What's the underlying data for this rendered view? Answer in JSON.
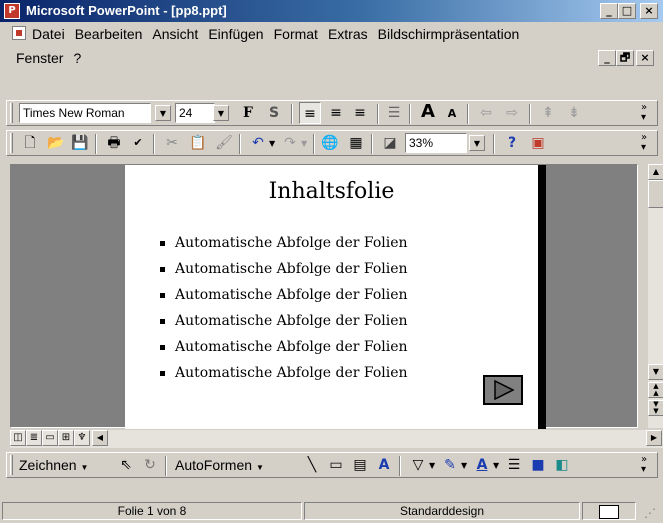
{
  "window": {
    "title": "Microsoft PowerPoint - [pp8.ppt]",
    "app_icon": "powerpoint-icon",
    "caption_buttons": {
      "minimize": "_",
      "maximize": "□",
      "close": "×"
    },
    "doc_buttons": {
      "minimize": "_",
      "restore": "🗗",
      "close": "×"
    }
  },
  "menu": {
    "items": [
      "Datei",
      "Bearbeiten",
      "Ansicht",
      "Einfügen",
      "Format",
      "Extras",
      "Bildschirmpräsentation"
    ],
    "items_row2": [
      "Fenster",
      "?"
    ]
  },
  "format_toolbar": {
    "font": "Times New Roman",
    "size": "24",
    "bold": "F",
    "shadow": "S"
  },
  "standard_toolbar": {
    "zoom": "33%"
  },
  "slide": {
    "title": "Inhaltsfolie",
    "bullets": [
      "Automatische Abfolge der Folien",
      "Automatische Abfolge der Folien",
      "Automatische Abfolge der Folien",
      "Automatische Abfolge der Folien",
      "Automatische Abfolge der Folien",
      "Automatische Abfolge der Folien"
    ],
    "action_button_icon": "play-icon"
  },
  "drawing_toolbar": {
    "draw_label": "Zeichnen",
    "autoshapes_label": "AutoFormen"
  },
  "status": {
    "slide": "Folie 1 von 8",
    "design": "Standarddesign"
  }
}
